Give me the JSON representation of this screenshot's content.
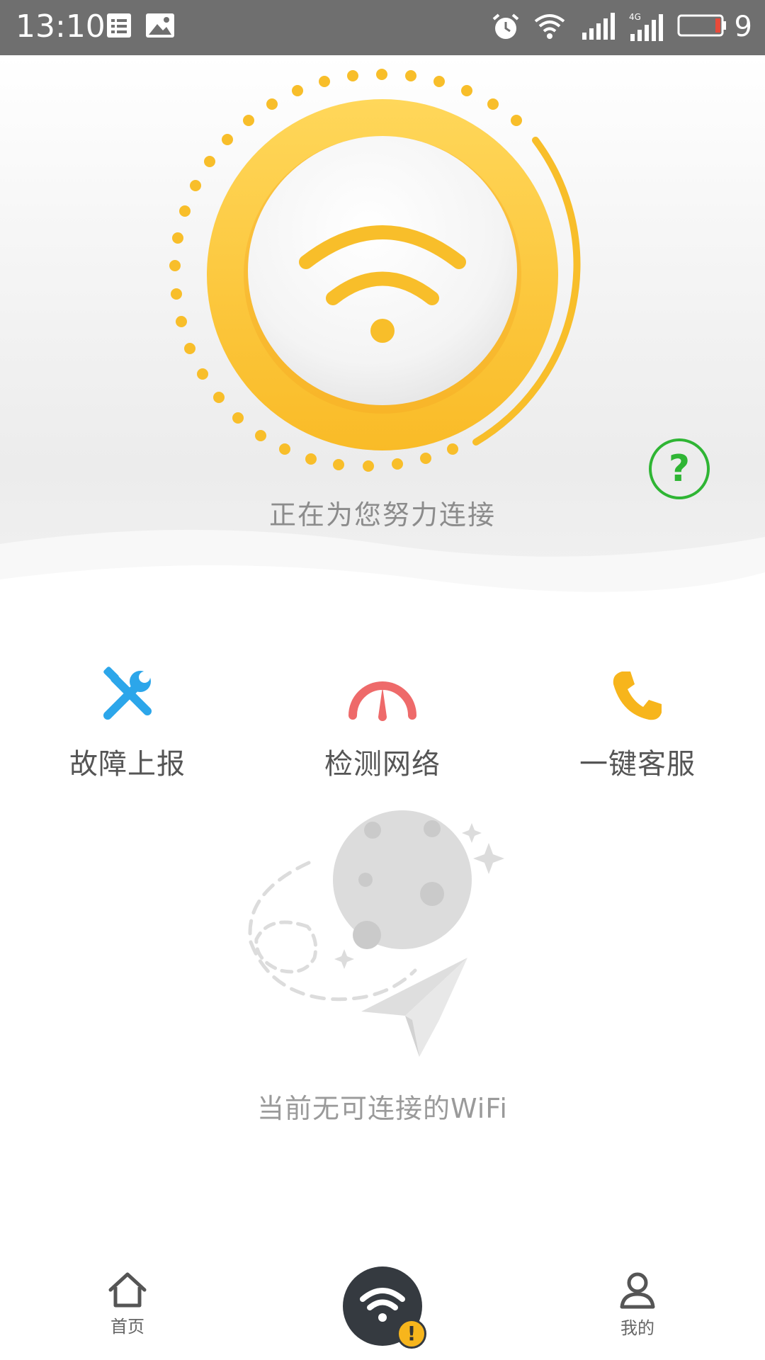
{
  "status_bar": {
    "time": "13:10",
    "battery_level": "9"
  },
  "hero": {
    "status_text": "正在为您努力连接",
    "help_symbol": "?"
  },
  "actions": [
    {
      "label": "故障上报",
      "icon": "tools-icon"
    },
    {
      "label": "检测网络",
      "icon": "speedometer-icon"
    },
    {
      "label": "一键客服",
      "icon": "phone-icon"
    }
  ],
  "empty_state": {
    "text": "当前无可连接的WiFi",
    "icon": "moon-paper-plane-icon"
  },
  "bottom_nav": {
    "home_label": "首页",
    "wifi_warning": "!",
    "profile_label": "我的"
  },
  "colors": {
    "accent_yellow": "#f8be2a",
    "help_green": "#2fb534",
    "tools_blue": "#2ca6ea",
    "gauge_red": "#ee6a6a",
    "phone_yellow": "#f7b51c"
  }
}
